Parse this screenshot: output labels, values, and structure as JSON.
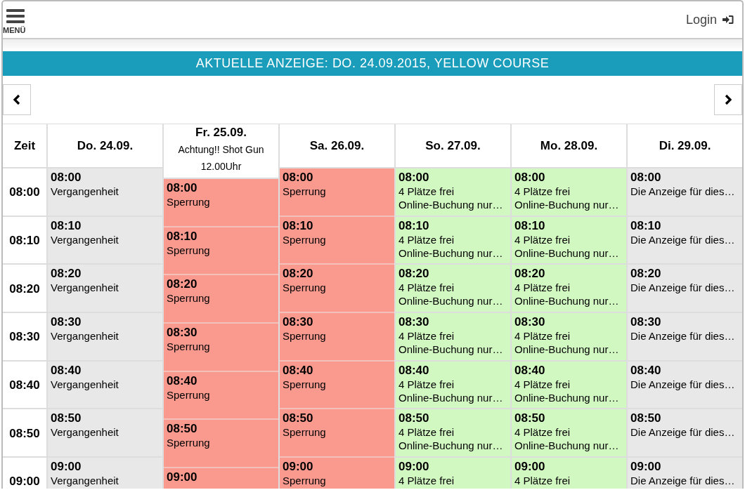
{
  "header": {
    "menu_label": "MENÜ",
    "login_label": "Login"
  },
  "banner": "AKTUELLE ANZEIGE: DO. 24.09.2015, YELLOW COURSE",
  "time_column": {
    "heading": "Zeit",
    "times": [
      "08:00",
      "08:10",
      "08:20",
      "08:30",
      "08:40",
      "08:50",
      "09:00"
    ]
  },
  "days": [
    {
      "heading": "Do. 24.09.",
      "cells": [
        {
          "kind": "past",
          "time": "08:00",
          "lines": [
            "Vergangenheit"
          ]
        },
        {
          "kind": "past",
          "time": "08:10",
          "lines": [
            "Vergangenheit"
          ]
        },
        {
          "kind": "past",
          "time": "08:20",
          "lines": [
            "Vergangenheit"
          ]
        },
        {
          "kind": "past",
          "time": "08:30",
          "lines": [
            "Vergangenheit"
          ]
        },
        {
          "kind": "past",
          "time": "08:40",
          "lines": [
            "Vergangenheit"
          ]
        },
        {
          "kind": "past",
          "time": "08:50",
          "lines": [
            "Vergangenheit"
          ]
        },
        {
          "kind": "past",
          "time": "09:00",
          "lines": [
            "Vergangenheit"
          ]
        }
      ]
    },
    {
      "heading": "Fr. 25.09.",
      "note": "Achtung!! Shot Gun 12.00Uhr",
      "cells": [
        {
          "kind": "blocked",
          "time": "08:00",
          "lines": [
            "Sperrung"
          ]
        },
        {
          "kind": "blocked",
          "time": "08:10",
          "lines": [
            "Sperrung"
          ]
        },
        {
          "kind": "blocked",
          "time": "08:20",
          "lines": [
            "Sperrung"
          ]
        },
        {
          "kind": "blocked",
          "time": "08:30",
          "lines": [
            "Sperrung"
          ]
        },
        {
          "kind": "blocked",
          "time": "08:40",
          "lines": [
            "Sperrung"
          ]
        },
        {
          "kind": "blocked",
          "time": "08:50",
          "lines": [
            "Sperrung"
          ]
        },
        {
          "kind": "blocked",
          "time": "09:00"
        }
      ]
    },
    {
      "heading": "Sa. 26.09.",
      "cells": [
        {
          "kind": "blocked",
          "time": "08:00",
          "lines": [
            "Sperrung"
          ]
        },
        {
          "kind": "blocked",
          "time": "08:10",
          "lines": [
            "Sperrung"
          ]
        },
        {
          "kind": "blocked",
          "time": "08:20",
          "lines": [
            "Sperrung"
          ]
        },
        {
          "kind": "blocked",
          "time": "08:30",
          "lines": [
            "Sperrung"
          ]
        },
        {
          "kind": "blocked",
          "time": "08:40",
          "lines": [
            "Sperrung"
          ]
        },
        {
          "kind": "blocked",
          "time": "08:50",
          "lines": [
            "Sperrung"
          ]
        },
        {
          "kind": "blocked",
          "time": "09:00",
          "lines": [
            "Sperrung"
          ]
        }
      ]
    },
    {
      "heading": "So. 27.09.",
      "cells": [
        {
          "kind": "free",
          "time": "08:00",
          "lines": [
            "4 Plätze frei",
            "Online-Buchung nur…"
          ]
        },
        {
          "kind": "free",
          "time": "08:10",
          "lines": [
            "4 Plätze frei",
            "Online-Buchung nur…"
          ]
        },
        {
          "kind": "free",
          "time": "08:20",
          "lines": [
            "4 Plätze frei",
            "Online-Buchung nur…"
          ]
        },
        {
          "kind": "free",
          "time": "08:30",
          "lines": [
            "4 Plätze frei",
            "Online-Buchung nur…"
          ]
        },
        {
          "kind": "free",
          "time": "08:40",
          "lines": [
            "4 Plätze frei",
            "Online-Buchung nur…"
          ]
        },
        {
          "kind": "free",
          "time": "08:50",
          "lines": [
            "4 Plätze frei",
            "Online-Buchung nur…"
          ]
        },
        {
          "kind": "free",
          "time": "09:00",
          "lines": [
            "4 Plätze frei"
          ]
        }
      ]
    },
    {
      "heading": "Mo. 28.09.",
      "cells": [
        {
          "kind": "free",
          "time": "08:00",
          "lines": [
            "4 Plätze frei",
            "Online-Buchung nur…"
          ]
        },
        {
          "kind": "free",
          "time": "08:10",
          "lines": [
            "4 Plätze frei",
            "Online-Buchung nur…"
          ]
        },
        {
          "kind": "free",
          "time": "08:20",
          "lines": [
            "4 Plätze frei",
            "Online-Buchung nur…"
          ]
        },
        {
          "kind": "free",
          "time": "08:30",
          "lines": [
            "4 Plätze frei",
            "Online-Buchung nur…"
          ]
        },
        {
          "kind": "free",
          "time": "08:40",
          "lines": [
            "4 Plätze frei",
            "Online-Buchung nur…"
          ]
        },
        {
          "kind": "free",
          "time": "08:50",
          "lines": [
            "4 Plätze frei",
            "Online-Buchung nur…"
          ]
        },
        {
          "kind": "free",
          "time": "09:00",
          "lines": [
            "4 Plätze frei"
          ]
        }
      ]
    },
    {
      "heading": "Di. 29.09.",
      "cells": [
        {
          "kind": "unavailable",
          "time": "08:00",
          "lines": [
            "Die Anzeige für dies…"
          ]
        },
        {
          "kind": "unavailable",
          "time": "08:10",
          "lines": [
            "Die Anzeige für dies…"
          ]
        },
        {
          "kind": "unavailable",
          "time": "08:20",
          "lines": [
            "Die Anzeige für dies…"
          ]
        },
        {
          "kind": "unavailable",
          "time": "08:30",
          "lines": [
            "Die Anzeige für dies…"
          ]
        },
        {
          "kind": "unavailable",
          "time": "08:40",
          "lines": [
            "Die Anzeige für dies…"
          ]
        },
        {
          "kind": "unavailable",
          "time": "08:50",
          "lines": [
            "Die Anzeige für dies…"
          ]
        },
        {
          "kind": "unavailable",
          "time": "09:00",
          "lines": [
            "Die Anzeige für dies…"
          ]
        }
      ]
    }
  ]
}
